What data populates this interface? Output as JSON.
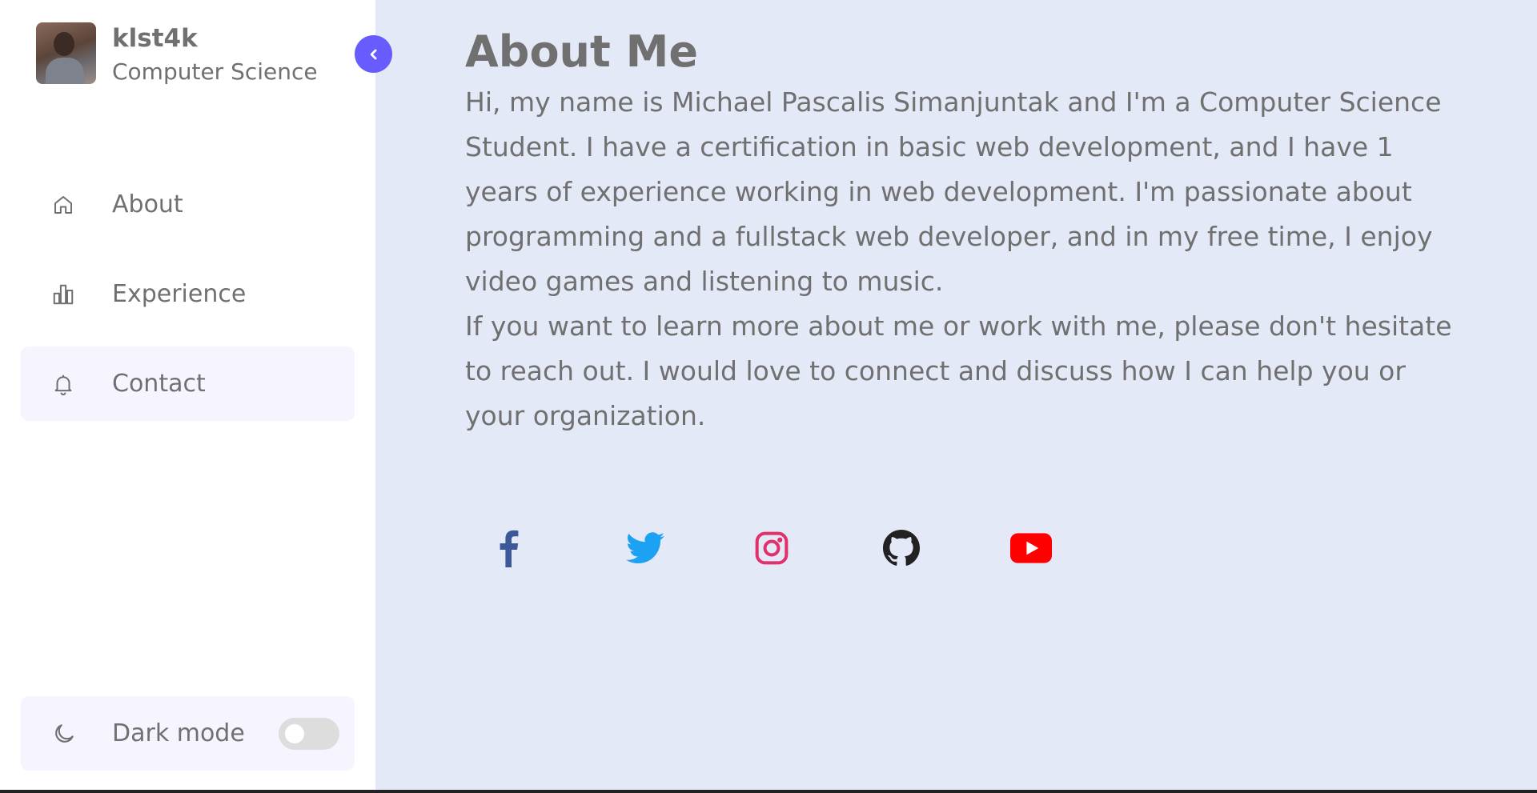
{
  "profile": {
    "name": "klst4k",
    "role": "Computer Science"
  },
  "sidebar": {
    "items": [
      {
        "label": "About",
        "icon": "home-icon"
      },
      {
        "label": "Experience",
        "icon": "bar-chart-icon"
      },
      {
        "label": "Contact",
        "icon": "bell-icon"
      }
    ],
    "dark_mode_label": "Dark mode"
  },
  "main": {
    "title": "About Me",
    "paragraph1": "Hi, my name is Michael Pascalis Simanjuntak and I'm a Computer Science Student. I have a certification in basic web development, and I have 1 years of experience working in web development. I'm passionate about programming and a fullstack web developer, and in my free time, I enjoy video games and listening to music.",
    "paragraph2": "If you want to learn more about me or work with me, please don't hesitate to reach out. I would love to connect and discuss how I can help you or your organization."
  },
  "socials": [
    {
      "name": "facebook-icon",
      "color": "#3b5998"
    },
    {
      "name": "twitter-icon",
      "color": "#1da1f2"
    },
    {
      "name": "instagram-icon",
      "color": "#e1306c"
    },
    {
      "name": "github-icon",
      "color": "#222222"
    },
    {
      "name": "youtube-icon",
      "color": "#ff0000"
    }
  ],
  "colors": {
    "accent": "#695cfe",
    "background": "#e4e9f7",
    "sidebar": "#ffffff",
    "text": "#707070"
  }
}
